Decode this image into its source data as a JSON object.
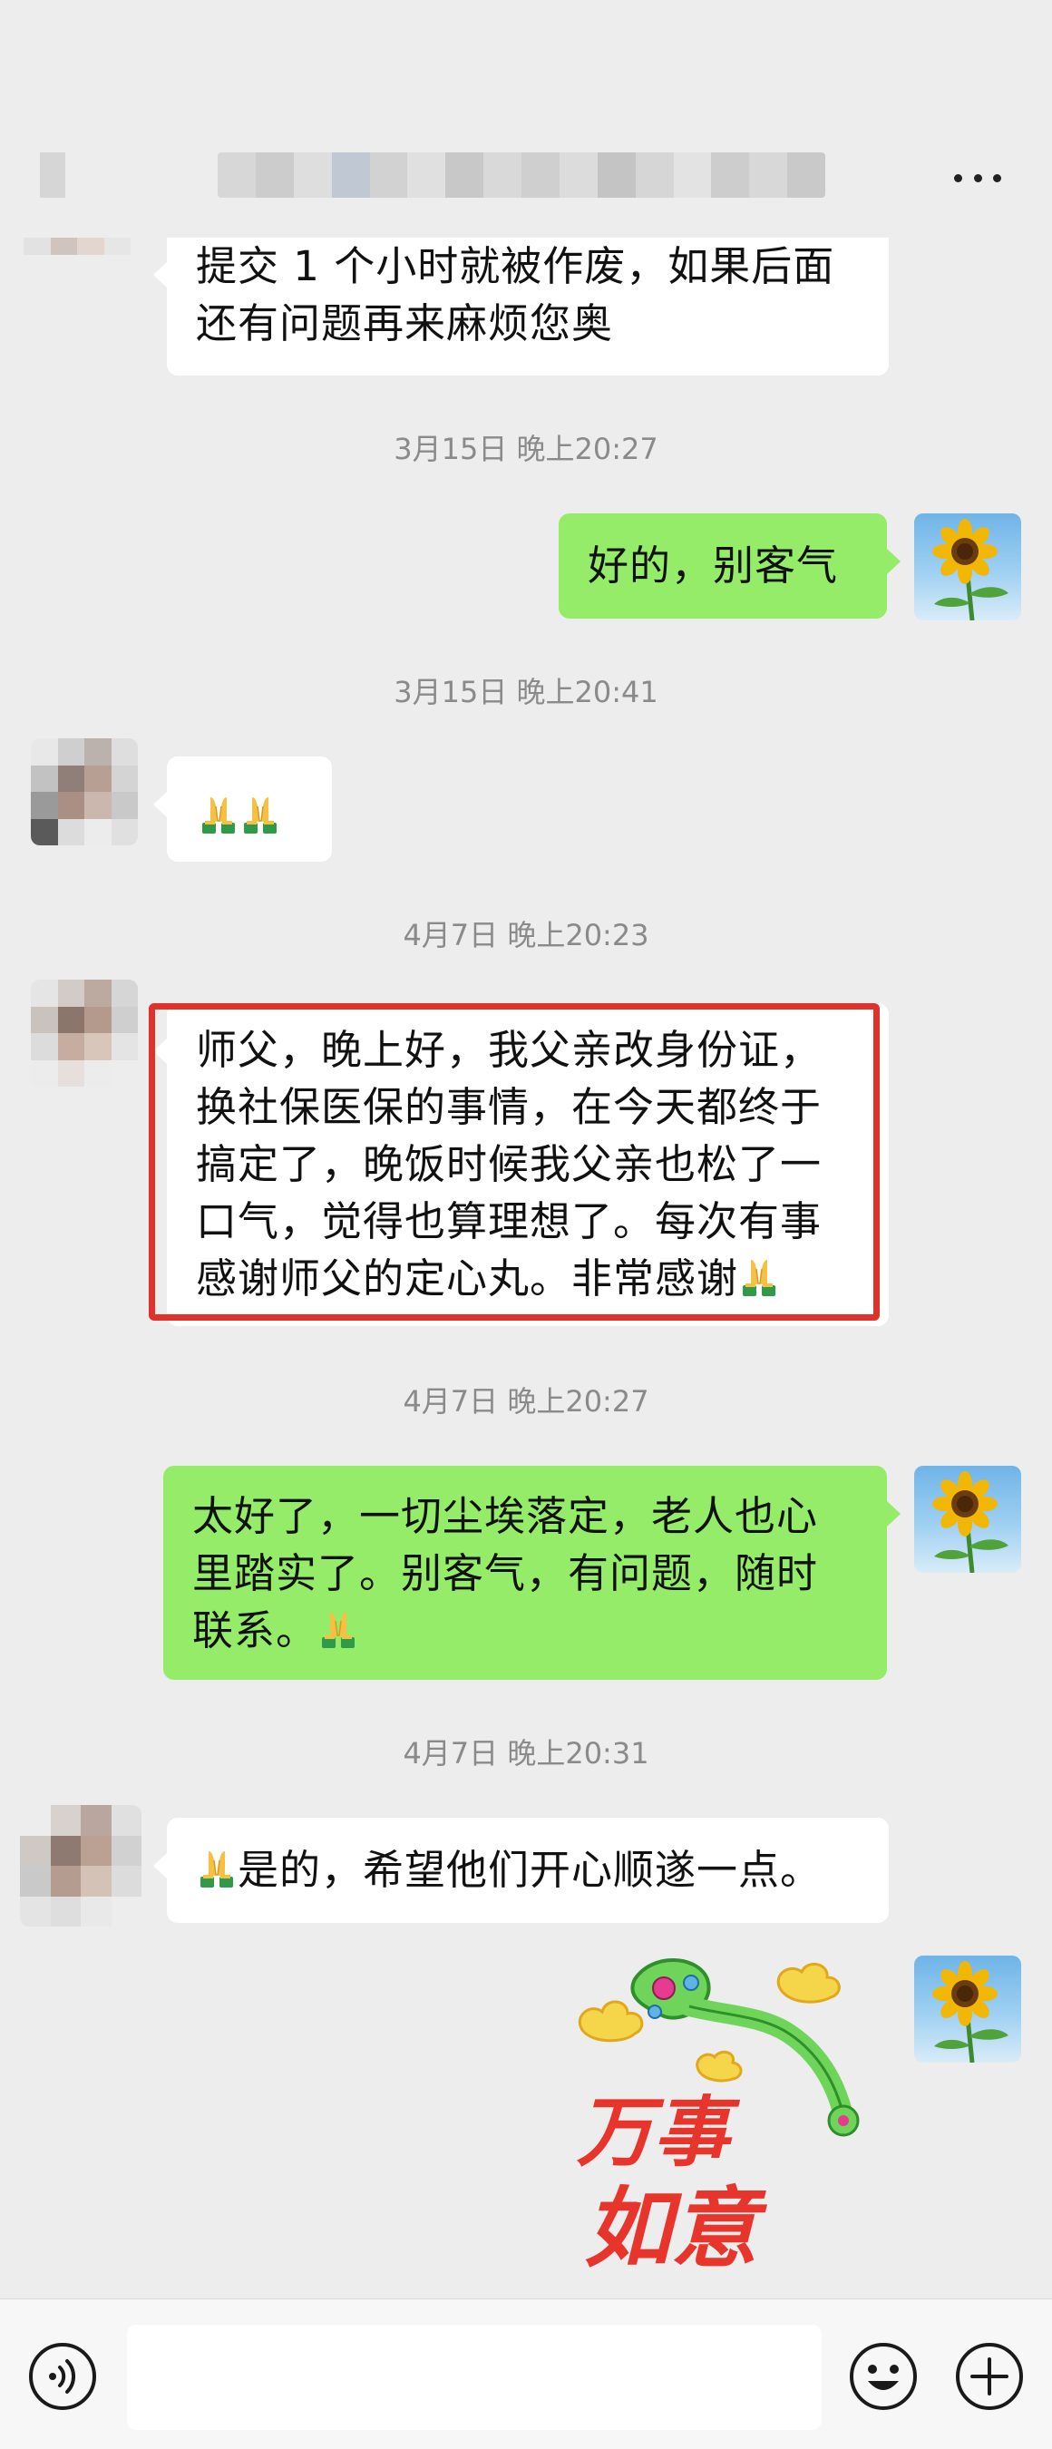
{
  "colors": {
    "background": "#ededed",
    "incoming_bubble": "#ffffff",
    "outgoing_bubble": "#95ec69",
    "timestamp": "#8a8a8a",
    "highlight_border": "#e0322b"
  },
  "header": {
    "title_obscured": true,
    "more_icon": "more-dots-icon"
  },
  "messages": [
    {
      "side": "in",
      "lines": [
        "提交 1 个小时就被作废，如果后面",
        "还有问题再来麻烦您奥"
      ]
    },
    {
      "timestamp": "3月15日 晚上20:27"
    },
    {
      "side": "out",
      "lines": [
        "好的，别客气"
      ]
    },
    {
      "timestamp": "3月15日 晚上20:41"
    },
    {
      "side": "in",
      "emoji": [
        "folded-hands-icon",
        "folded-hands-icon"
      ]
    },
    {
      "timestamp": "4月7日 晚上20:23"
    },
    {
      "side": "in",
      "highlighted": true,
      "lines": [
        "师父，晚上好，我父亲改身份证，",
        "换社保医保的事情，在今天都终于",
        "搞定了，晚饭时候我父亲也松了一",
        "口气，觉得也算理想了。每次有事",
        "感谢师父的定心丸。非常感谢"
      ],
      "trailing_emoji": "folded-hands-icon"
    },
    {
      "timestamp": "4月7日 晚上20:27"
    },
    {
      "side": "out",
      "lines": [
        "太好了，一切尘埃落定，老人也心",
        "里踏实了。别客气，有问题，随时",
        "联系。"
      ],
      "trailing_emoji": "folded-hands-icon"
    },
    {
      "timestamp": "4月7日 晚上20:31"
    },
    {
      "side": "in",
      "leading_emoji": "folded-hands-icon",
      "lines": [
        "是的，希望他们开心顺遂一点。"
      ]
    },
    {
      "side": "out",
      "sticker": "ruyi-sticker",
      "sticker_text": [
        "万事",
        "如意"
      ]
    }
  ],
  "input_bar": {
    "voice_icon": "voice-icon",
    "emoji_icon": "emoji-face-icon",
    "plus_icon": "plus-icon",
    "input_value": ""
  }
}
